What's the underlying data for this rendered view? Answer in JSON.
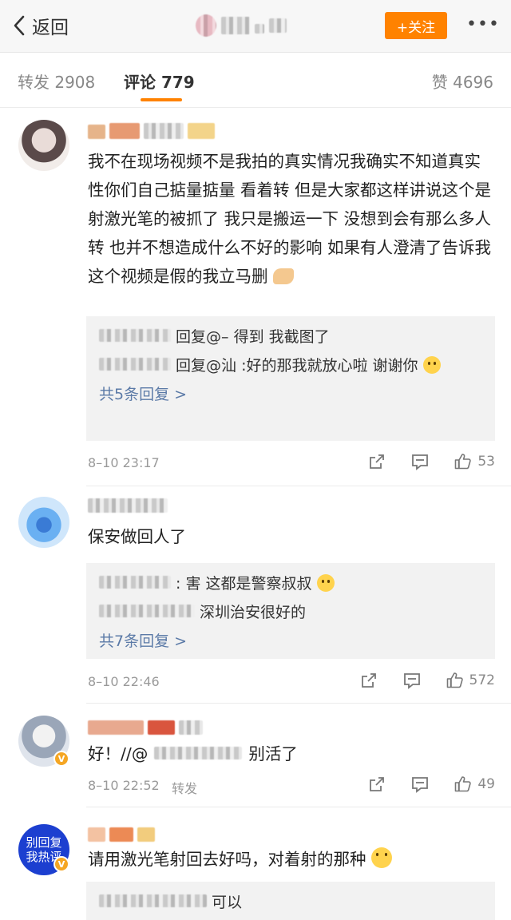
{
  "header": {
    "back_label": "返回",
    "follow_label": "+关注",
    "more_label": "•••"
  },
  "tabs": {
    "repost": "转发 2908",
    "comment": "评论 779",
    "like": "赞 4696"
  },
  "colors": {
    "accent": "#ff8200",
    "link": "#5b7aa7"
  },
  "comments": [
    {
      "text": "我不在现场视频不是我拍的真实情况我确实不知道真实性你们自己掂量掂量 看着转 但是大家都这样讲说这个是射激光笔的被抓了 我只是搬运一下 没想到会有那么多人转 也并不想造成什么不好的影响 如果有人澄清了告诉我这个视频是假的我立马删",
      "replies": [
        "回复@– 得到 我截图了",
        "回复@汕 :好的那我就放心啦 谢谢你"
      ],
      "more_replies": "共5条回复 >",
      "time": "8–10 23:17",
      "likes": "53"
    },
    {
      "text": "保安做回人了",
      "replies": [
        ": 害 这都是警察叔叔",
        "深圳治安很好的"
      ],
      "more_replies": "共7条回复 >",
      "time": "8–10 22:46",
      "likes": "572"
    },
    {
      "text_prefix": "好！//@",
      "text_suffix": "别活了",
      "time": "8–10 22:52",
      "repost": "转发",
      "likes": "49"
    },
    {
      "avatar_text_1": "别回复",
      "avatar_text_2": "我热评",
      "text": "请用激光笔射回去好吗，对着射的那种",
      "replies": [
        "可以"
      ]
    }
  ]
}
